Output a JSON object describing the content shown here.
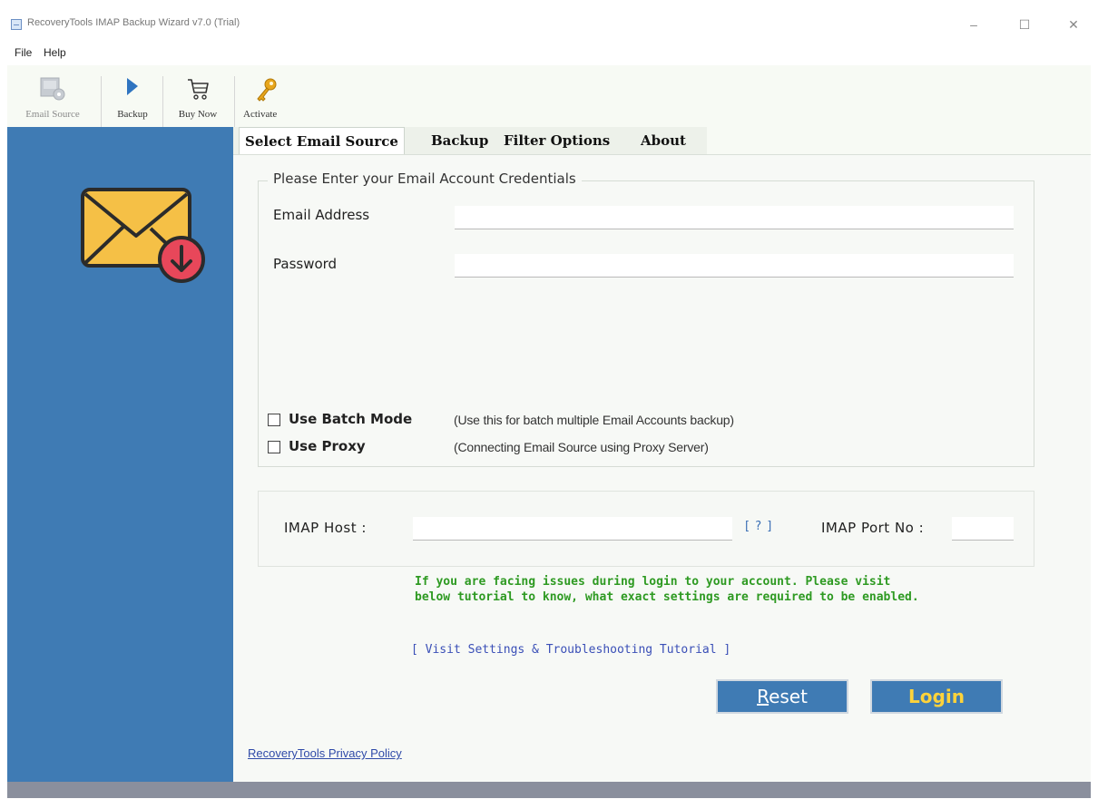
{
  "window": {
    "title": "RecoveryTools IMAP Backup Wizard v7.0 (Trial)",
    "controls": {
      "minimize": "–",
      "maximize": "☐",
      "close": "✕"
    }
  },
  "menu": {
    "items": [
      "File",
      "Help"
    ]
  },
  "toolbar": {
    "buttons": [
      {
        "label": "Email Source",
        "icon": "email-source-icon",
        "enabled": false
      },
      {
        "label": "Backup",
        "icon": "play-icon",
        "enabled": true
      },
      {
        "label": "Buy Now",
        "icon": "cart-icon",
        "enabled": true
      },
      {
        "label": "Activate",
        "icon": "key-icon",
        "enabled": true
      }
    ]
  },
  "tabs": {
    "items": [
      "Select Email Source",
      "Backup",
      "Filter Options",
      "About"
    ],
    "active": "Select Email Source"
  },
  "credentials": {
    "legend": "Please Enter your Email Account Credentials",
    "email_label": "Email Address",
    "email_value": "",
    "password_label": "Password",
    "password_value": "",
    "batch_label": "Use Batch Mode",
    "batch_desc": "(Use this for batch multiple Email Accounts backup)",
    "batch_checked": false,
    "proxy_label": "Use Proxy",
    "proxy_desc": "(Connecting Email Source using Proxy Server)",
    "proxy_checked": false
  },
  "imap": {
    "host_label": "IMAP Host :",
    "host_value": "",
    "help": "[ ? ]",
    "port_label": "IMAP Port No :",
    "port_value": ""
  },
  "notice": {
    "text": "If you are facing issues during login to your account. Please visit below tutorial to know, what exact settings are required to be enabled.",
    "color": "#2e9a22"
  },
  "tutorial_link": "[ Visit Settings & Troubleshooting Tutorial ]",
  "buttons": {
    "reset_first": "R",
    "reset_rest": "eset",
    "login": "Login"
  },
  "privacy_link": "RecoveryTools Privacy Policy",
  "colors": {
    "sidebar": "#3f7bb4",
    "button": "#3f7bb4",
    "login_text": "#ffd33a",
    "link": "#2f4aa8"
  }
}
